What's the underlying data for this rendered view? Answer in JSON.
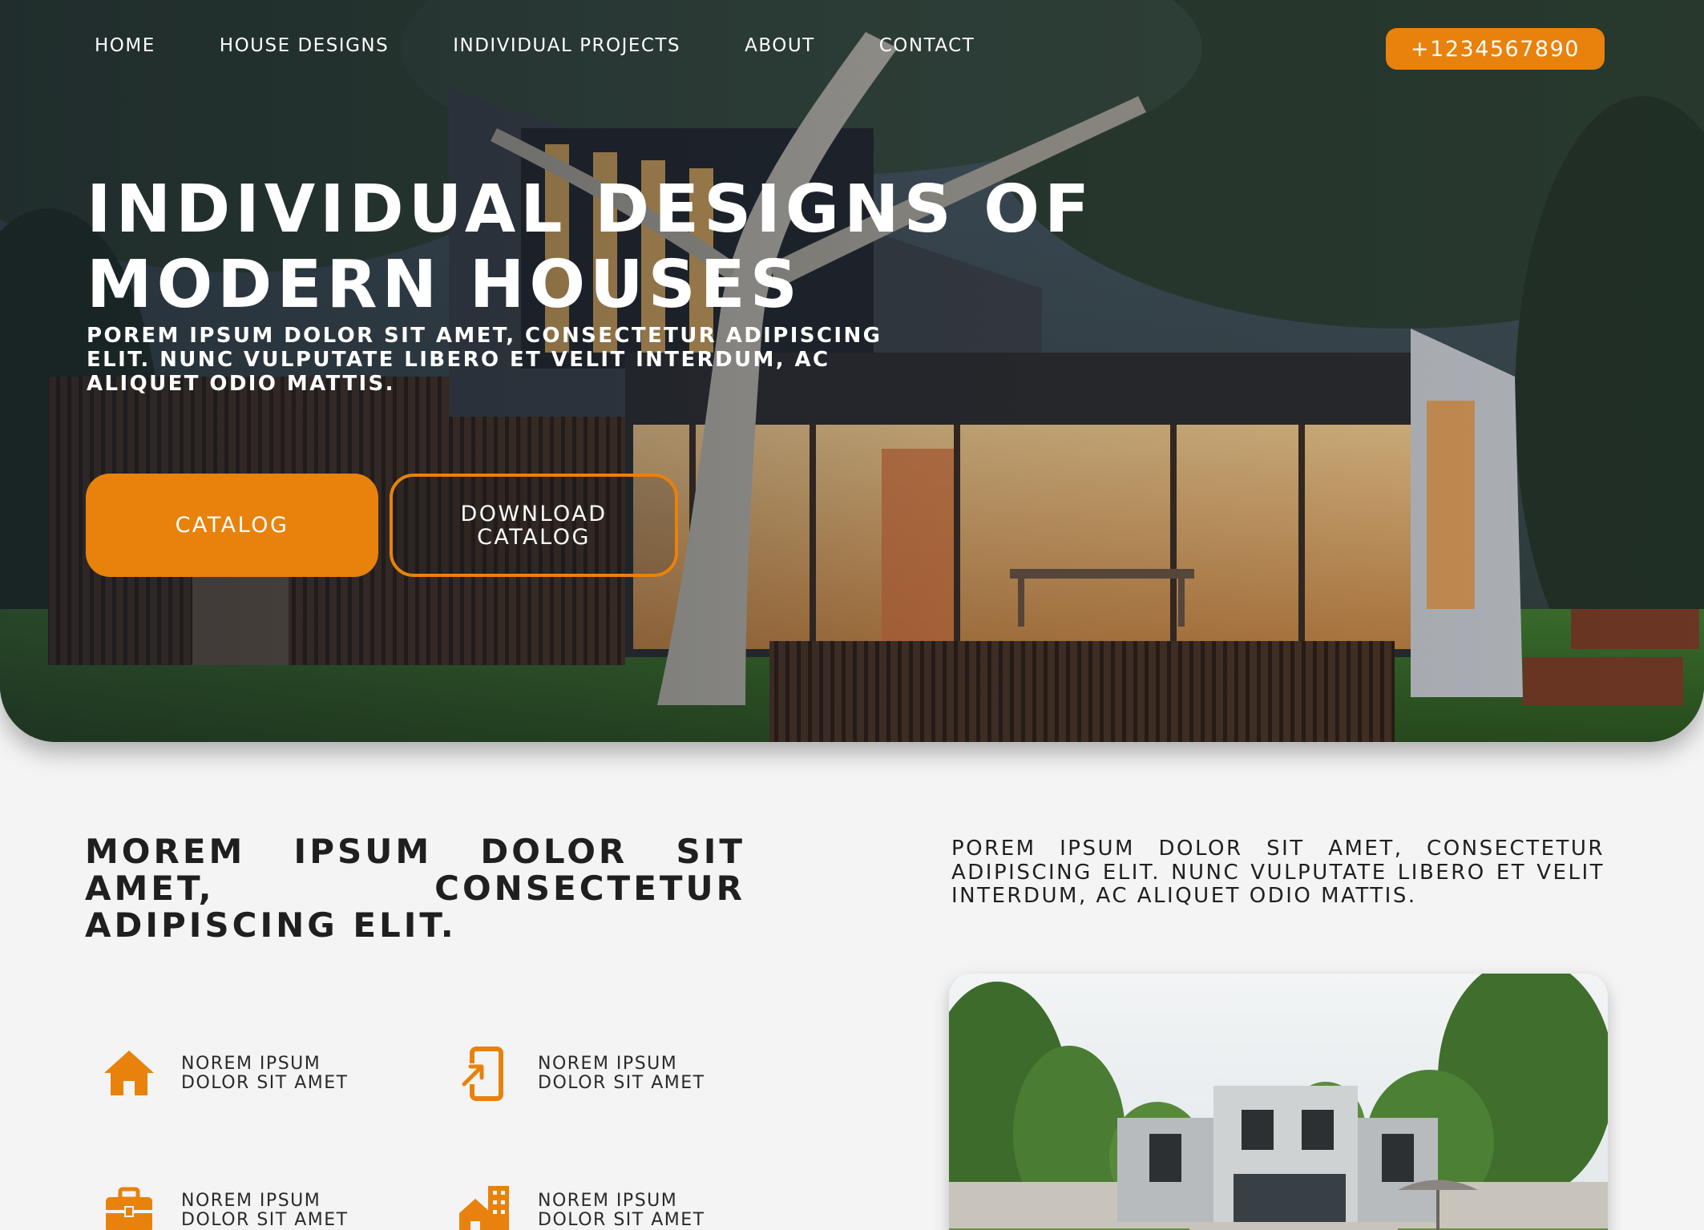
{
  "nav": {
    "items": [
      "HOME",
      "HOUSE DESIGNS",
      "INDIVIDUAL PROJECTS",
      "ABOUT",
      "CONTACT"
    ],
    "phone": "+1234567890"
  },
  "hero": {
    "title": "INDIVIDUAL DESIGNS OF MODERN HOUSES",
    "subtitle": "POREM IPSUM DOLOR SIT AMET, CONSECTETUR ADIPISCING ELIT. NUNC VULPUTATE LIBERO ET VELIT INTERDUM, AC ALIQUET ODIO MATTIS.",
    "catalog_label": "CATALOG",
    "download_label": "DOWNLOAD CATALOG"
  },
  "section": {
    "heading": "MOREM IPSUM DOLOR SIT AMET, CONSECTETUR ADIPISCING ELIT.",
    "text": "POREM IPSUM DOLOR SIT AMET, CONSECTETUR ADIPISCING ELIT. NUNC VULPUTATE LIBERO ET VELIT INTERDUM, AC ALIQUET ODIO MATTIS."
  },
  "features": [
    {
      "icon": "house-icon",
      "label": "NOREM IPSUM DOLOR SIT AMET"
    },
    {
      "icon": "phone-share-icon",
      "label": "NOREM IPSUM DOLOR SIT AMET"
    },
    {
      "icon": "briefcase-icon",
      "label": "NOREM IPSUM DOLOR SIT AMET"
    },
    {
      "icon": "buildings-icon",
      "label": "NOREM IPSUM DOLOR SIT AMET"
    }
  ],
  "colors": {
    "accent": "#e8820c",
    "background": "#f4f4f4",
    "text": "#1f1f1f"
  }
}
